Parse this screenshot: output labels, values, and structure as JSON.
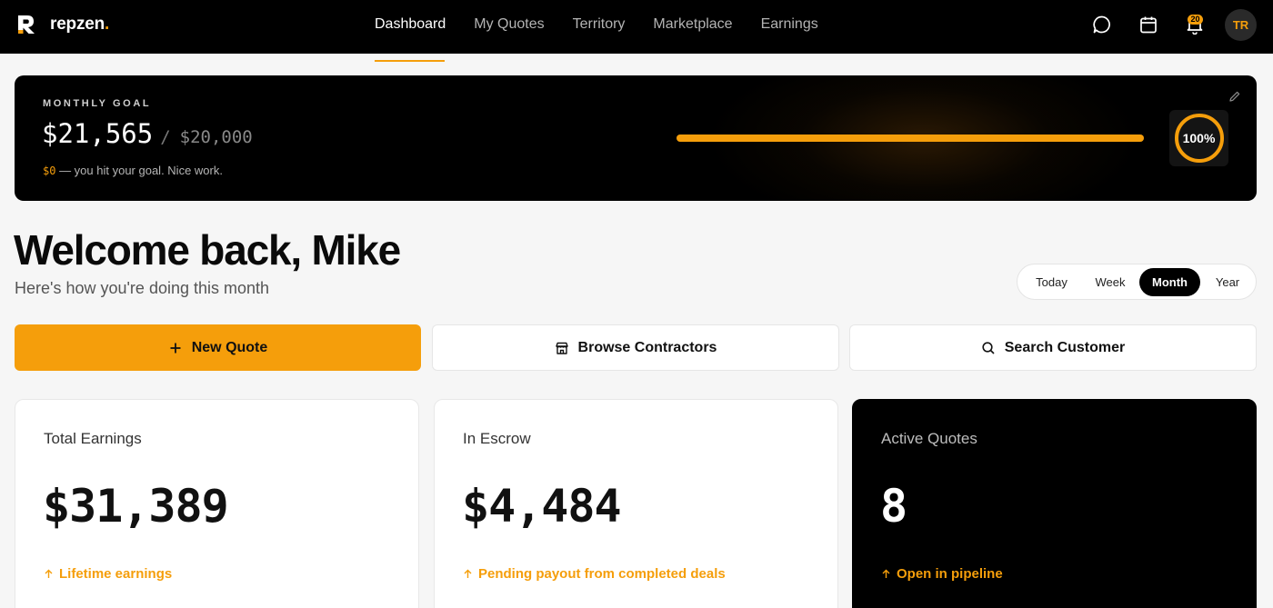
{
  "brand": {
    "name": "repzen",
    "dot": ".",
    "accent": "#f59e0b"
  },
  "nav": {
    "links": [
      {
        "label": "Dashboard",
        "active": true
      },
      {
        "label": "My Quotes",
        "active": false
      },
      {
        "label": "Territory",
        "active": false
      },
      {
        "label": "Marketplace",
        "active": false
      },
      {
        "label": "Earnings",
        "active": false
      }
    ],
    "icons": [
      "chat-icon",
      "calendar-icon",
      "bell-icon"
    ],
    "notifications": "20",
    "avatar_initials": "TR"
  },
  "goal": {
    "label": "MONTHLY GOAL",
    "current": "$21,565",
    "separator": "/",
    "target": "$20,000",
    "remaining": "$0",
    "note": " — you hit your goal. Nice work.",
    "progress": 1.0,
    "percent_label": "100%"
  },
  "welcome": {
    "title": "Welcome back, Mike",
    "subtitle": "Here's how you're doing this month"
  },
  "period": {
    "options": [
      "Today",
      "Week",
      "Month",
      "Year"
    ],
    "selected": "Month"
  },
  "actions": {
    "new_quote": "New Quote",
    "browse_contractors": "Browse Contractors",
    "search_customer": "Search Customer"
  },
  "stats": [
    {
      "title": "Total Earnings",
      "value": "$31,389",
      "foot": "Lifetime earnings",
      "dark": false
    },
    {
      "title": "In Escrow",
      "value": "$4,484",
      "foot": "Pending payout from completed deals",
      "dark": false
    },
    {
      "title": "Active Quotes",
      "value": "8",
      "foot": "Open in pipeline",
      "dark": true
    }
  ]
}
